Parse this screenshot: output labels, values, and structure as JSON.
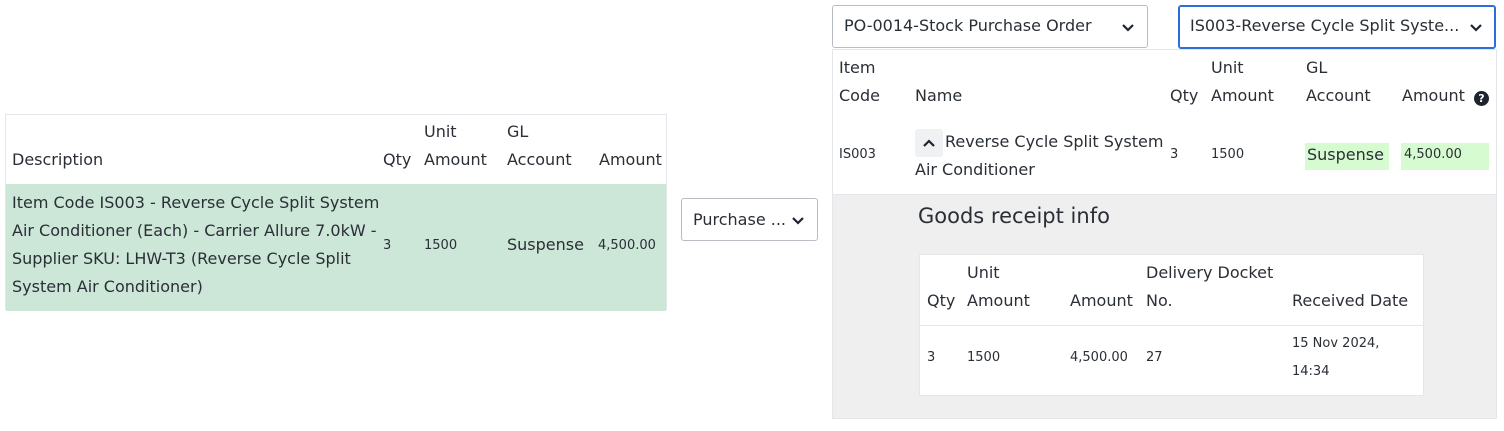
{
  "left_table": {
    "headers": {
      "description": "Description",
      "qty": "Qty",
      "unit_amount_1": "Unit",
      "unit_amount_2": "Amount",
      "gl_account_1": "GL",
      "gl_account_2": "Account",
      "amount": "Amount"
    },
    "row": {
      "description_lines": [
        "Item Code IS003 - Reverse Cycle Split System",
        "Air Conditioner (Each) - Carrier Allure 7.0kW -",
        "Supplier SKU: LHW-T3 (Reverse Cycle Split",
        "System Air Conditioner)"
      ],
      "qty": "3",
      "unit_amount": "1500",
      "gl_account": "Suspense",
      "amount": "4,500.00"
    }
  },
  "match_dropdown": {
    "value": "Purchase ..."
  },
  "po_dropdown": {
    "value": "PO-0014-Stock Purchase Order"
  },
  "item_dropdown": {
    "value": "IS003-Reverse Cycle Split Syste..."
  },
  "right_table": {
    "headers": {
      "item_code_1": "Item",
      "item_code_2": "Code",
      "name": "Name",
      "qty": "Qty",
      "unit_amount_1": "Unit",
      "unit_amount_2": "Amount",
      "gl_account_1": "GL",
      "gl_account_2": "Account",
      "amount": "Amount"
    },
    "row": {
      "item_code": "IS003",
      "name_line1": "Reverse Cycle Split System",
      "name_line2": "Air Conditioner",
      "qty": "3",
      "unit_amount": "1500",
      "gl_account": "Suspense",
      "amount": "4,500.00"
    }
  },
  "goods_receipt": {
    "title": "Goods receipt info",
    "headers": {
      "qty": "Qty",
      "unit_amount_1": "Unit",
      "unit_amount_2": "Amount",
      "amount": "Amount",
      "docket_1": "Delivery Docket",
      "docket_2": "No.",
      "received_date": "Received Date"
    },
    "row": {
      "qty": "3",
      "unit_amount": "1500",
      "amount": "4,500.00",
      "docket": "27",
      "received_date_1": "15 Nov 2024,",
      "received_date_2": "14:34"
    }
  },
  "colors": {
    "matched_row": "#cce6d8",
    "highlight": "#d7fbd0",
    "focus_border": "#2b6fd6",
    "panel_bg": "#efefef"
  },
  "icons": {
    "dropdown": "chevron-down-icon",
    "collapse": "chevron-up-icon",
    "help": "help-circle-icon"
  }
}
